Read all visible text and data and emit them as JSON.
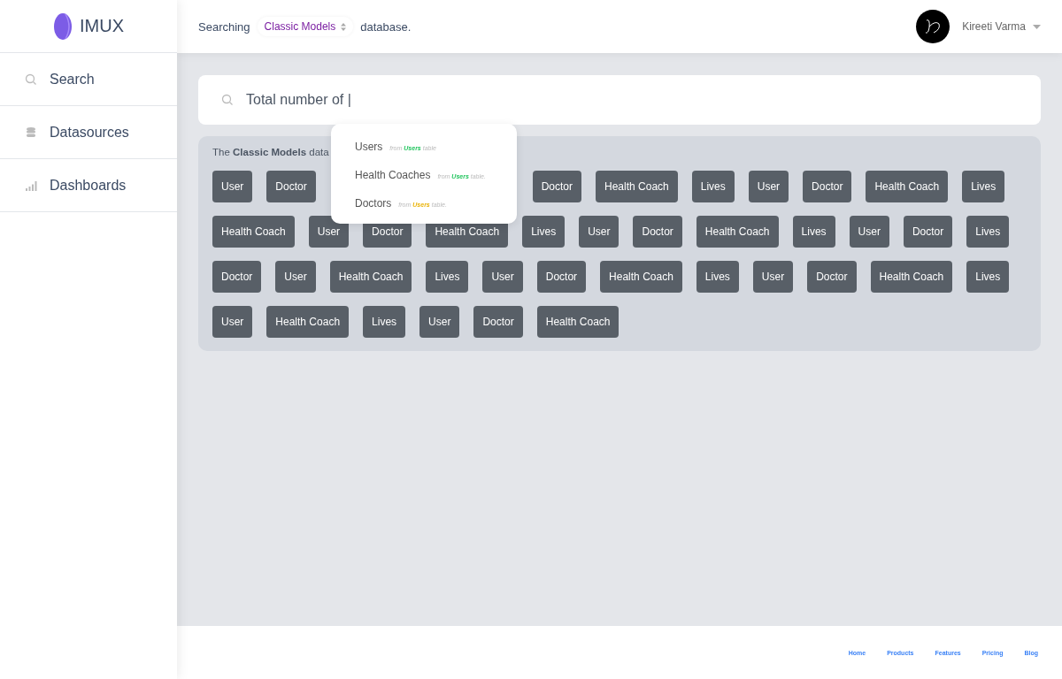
{
  "brand": {
    "name": "IMUX"
  },
  "sidebar": {
    "items": [
      {
        "label": "Search",
        "kind": "search"
      },
      {
        "label": "Datasources",
        "kind": "database"
      },
      {
        "label": "Dashboards",
        "kind": "bars"
      }
    ]
  },
  "header": {
    "prefix": "Searching",
    "database": "Classic Models",
    "suffix": "database.",
    "user": "Kireeti Varma"
  },
  "search": {
    "value": "Total number of |"
  },
  "suggestions": [
    {
      "label": "Users",
      "from": "from",
      "table": "Users",
      "table_suffix": "table",
      "color": "#22c55e"
    },
    {
      "label": "Health Coaches",
      "from": "from",
      "table": "Users",
      "table_suffix": "table.",
      "color": "#22c55e"
    },
    {
      "label": "Doctors",
      "from": "from",
      "table": "Users",
      "table_suffix": "table.",
      "color": "#eab308"
    }
  ],
  "panel": {
    "intro": "The **Classic Models** data",
    "chip_groups": [
      {
        "chips": [
          "User",
          "Doctor"
        ]
      },
      {
        "chips": [
          "Doctor",
          "Health Coach",
          "Lives",
          "User",
          "Doctor",
          "Health Coach",
          "Lives"
        ]
      },
      {
        "chips": [
          "Health Coach",
          "User",
          "Doctor",
          "Health Coach",
          "Lives",
          "User",
          "Doctor",
          "Health Coach",
          "Lives",
          "User",
          "Doctor",
          "Lives"
        ]
      },
      {
        "chips": [
          "Doctor",
          "User",
          "Health Coach",
          "Lives",
          "User",
          "Doctor",
          "Health Coach",
          "Lives",
          "User",
          "Doctor",
          "Health Coach",
          "Lives"
        ]
      },
      {
        "chips": [
          "User",
          "Health Coach",
          "Lives",
          "User",
          "Doctor",
          "Health Coach"
        ]
      }
    ]
  },
  "footer": {
    "links": [
      "Home",
      "Products",
      "Features",
      "Pricing",
      "Blog"
    ]
  }
}
